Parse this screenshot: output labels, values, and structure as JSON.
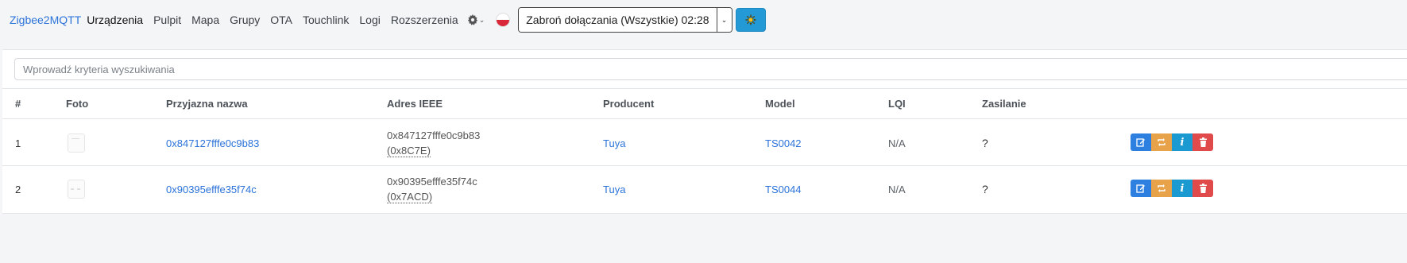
{
  "navbar": {
    "brand": "Zigbee2MQTT",
    "links": [
      "Urządzenia",
      "Pulpit",
      "Mapa",
      "Grupy",
      "OTA",
      "Touchlink",
      "Logi",
      "Rozszerzenia"
    ],
    "settings_icon": "gear-icon",
    "language_icon": "poland-flag-icon",
    "permit_join_label": "Zabroń dołączania (Wszystkie) 02:28",
    "theme_icon": "sun-icon"
  },
  "search": {
    "placeholder": "Wprowadź kryteria wyszukiwania"
  },
  "table": {
    "headers": [
      "#",
      "Foto",
      "Przyjazna nazwa",
      "Adres IEEE",
      "Producent",
      "Model",
      "LQI",
      "Zasilanie"
    ],
    "rows": [
      {
        "index": "1",
        "friendly_name": "0x847127fffe0c9b83",
        "ieee": "0x847127fffe0c9b83",
        "network_address": "(0x8C7E)",
        "manufacturer": "Tuya",
        "model": "TS0042",
        "lqi": "N/A",
        "power": "?"
      },
      {
        "index": "2",
        "friendly_name": "0x90395efffe35f74c",
        "ieee": "0x90395efffe35f74c",
        "network_address": "(0x7ACD)",
        "manufacturer": "Tuya",
        "model": "TS0044",
        "lqi": "N/A",
        "power": "?"
      }
    ],
    "action_icons": [
      "edit-icon",
      "swap-icon",
      "info-icon",
      "trash-icon"
    ]
  },
  "colors": {
    "accent": "#2b73d9",
    "edit": "#2d7fe0",
    "swap": "#e7a24a",
    "info": "#1b9ad1",
    "delete": "#e04a4a",
    "theme_button": "#2399d6"
  }
}
